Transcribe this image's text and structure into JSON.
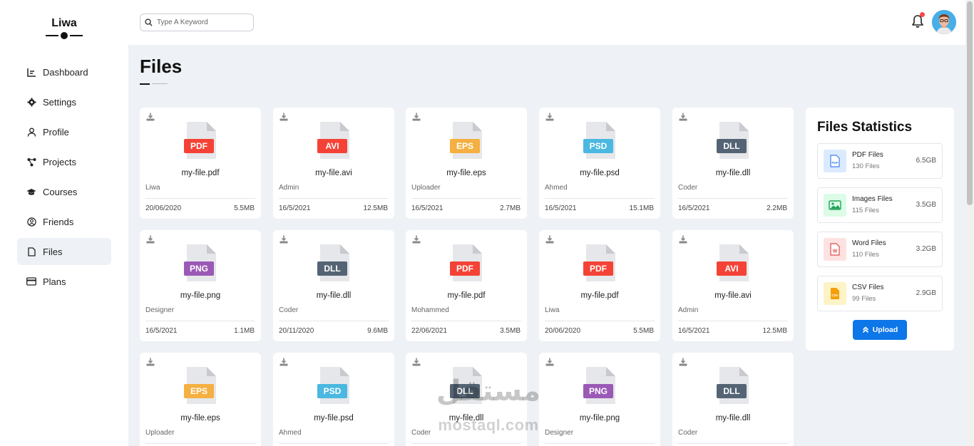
{
  "app": {
    "logo": "Liwa"
  },
  "sidebar": {
    "items": [
      {
        "label": "Dashboard",
        "icon": "chart-icon"
      },
      {
        "label": "Settings",
        "icon": "gear-icon"
      },
      {
        "label": "Profile",
        "icon": "user-icon"
      },
      {
        "label": "Projects",
        "icon": "nodes-icon"
      },
      {
        "label": "Courses",
        "icon": "graduation-cap-icon"
      },
      {
        "label": "Friends",
        "icon": "user-circle-icon"
      },
      {
        "label": "Files",
        "icon": "file-icon",
        "active": true
      },
      {
        "label": "Plans",
        "icon": "credit-card-icon"
      }
    ]
  },
  "header": {
    "search_placeholder": "Type A Keyword"
  },
  "page": {
    "title": "Files"
  },
  "files": [
    {
      "ext": "PDF",
      "color": "#f44336",
      "name": "my-file.pdf",
      "owner": "Liwa",
      "date": "20/06/2020",
      "size": "5.5MB"
    },
    {
      "ext": "AVI",
      "color": "#f44336",
      "name": "my-file.avi",
      "owner": "Admin",
      "date": "16/5/2021",
      "size": "12.5MB"
    },
    {
      "ext": "EPS",
      "color": "#f5b041",
      "name": "my-file.eps",
      "owner": "Uploader",
      "date": "16/5/2021",
      "size": "2.7MB"
    },
    {
      "ext": "PSD",
      "color": "#4ab8e0",
      "name": "my-file.psd",
      "owner": "Ahmed",
      "date": "16/5/2021",
      "size": "15.1MB"
    },
    {
      "ext": "DLL",
      "color": "#546474",
      "name": "my-file.dll",
      "owner": "Coder",
      "date": "16/5/2021",
      "size": "2.2MB"
    },
    {
      "ext": "PNG",
      "color": "#9b59b6",
      "name": "my-file.png",
      "owner": "Designer",
      "date": "16/5/2021",
      "size": "1.1MB"
    },
    {
      "ext": "DLL",
      "color": "#546474",
      "name": "my-file.dll",
      "owner": "Coder",
      "date": "20/11/2020",
      "size": "9.6MB"
    },
    {
      "ext": "PDF",
      "color": "#f44336",
      "name": "my-file.pdf",
      "owner": "Mohammed",
      "date": "22/06/2021",
      "size": "3.5MB"
    },
    {
      "ext": "PDF",
      "color": "#f44336",
      "name": "my-file.pdf",
      "owner": "Liwa",
      "date": "20/06/2020",
      "size": "5.5MB"
    },
    {
      "ext": "AVI",
      "color": "#f44336",
      "name": "my-file.avi",
      "owner": "Admin",
      "date": "16/5/2021",
      "size": "12.5MB"
    },
    {
      "ext": "EPS",
      "color": "#f5b041",
      "name": "my-file.eps",
      "owner": "Uploader",
      "date": "",
      "size": ""
    },
    {
      "ext": "PSD",
      "color": "#4ab8e0",
      "name": "my-file.psd",
      "owner": "Ahmed",
      "date": "",
      "size": ""
    },
    {
      "ext": "DLL",
      "color": "#546474",
      "name": "my-file.dll",
      "owner": "Coder",
      "date": "",
      "size": ""
    },
    {
      "ext": "PNG",
      "color": "#9b59b6",
      "name": "my-file.png",
      "owner": "Designer",
      "date": "",
      "size": ""
    },
    {
      "ext": "DLL",
      "color": "#546474",
      "name": "my-file.dll",
      "owner": "Coder",
      "date": "",
      "size": ""
    }
  ],
  "stats": {
    "title": "Files Statistics",
    "items": [
      {
        "name": "PDF Files",
        "count": "130 Files",
        "size": "6.5GB",
        "icon": "pdf-file-icon",
        "bg": "#dbeafe",
        "fg": "#3b82f6"
      },
      {
        "name": "Images Files",
        "count": "115 Files",
        "size": "3.5GB",
        "icon": "image-file-icon",
        "bg": "#dcfce7",
        "fg": "#22a05a"
      },
      {
        "name": "Word Files",
        "count": "110 Files",
        "size": "3.2GB",
        "icon": "word-file-icon",
        "bg": "#fee2e2",
        "fg": "#e14b4b"
      },
      {
        "name": "CSV Files",
        "count": "99 Files",
        "size": "2.9GB",
        "icon": "csv-file-icon",
        "bg": "#fef3c7",
        "fg": "#f59e0b"
      }
    ],
    "upload_label": "Upload"
  },
  "watermark": {
    "arabic": "مستقل",
    "latin": "mostaql.com"
  }
}
